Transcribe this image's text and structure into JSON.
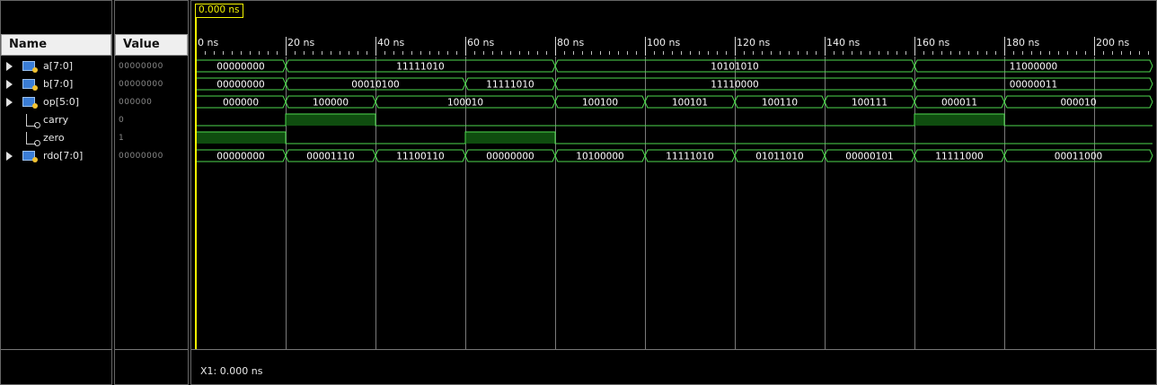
{
  "columns": {
    "name": "Name",
    "value": "Value"
  },
  "cursor": {
    "marker": "0.000 ns",
    "readout": "X1: 0.000 ns"
  },
  "timeline": {
    "unit": "ns",
    "start": 0,
    "end": 213,
    "ticks": [
      {
        "t": 0,
        "label": "0 ns"
      },
      {
        "t": 20,
        "label": "20 ns"
      },
      {
        "t": 40,
        "label": "40 ns"
      },
      {
        "t": 60,
        "label": "60 ns"
      },
      {
        "t": 80,
        "label": "80 ns"
      },
      {
        "t": 100,
        "label": "100 ns"
      },
      {
        "t": 120,
        "label": "120 ns"
      },
      {
        "t": 140,
        "label": "140 ns"
      },
      {
        "t": 160,
        "label": "160 ns"
      },
      {
        "t": 180,
        "label": "180 ns"
      },
      {
        "t": 200,
        "label": "200 ns"
      }
    ]
  },
  "signals": [
    {
      "name": "a[7:0]",
      "kind": "bus",
      "value": "00000000",
      "icon": "bus-signal-icon",
      "segments": [
        {
          "t0": 0,
          "t1": 20,
          "v": "00000000"
        },
        {
          "t0": 20,
          "t1": 80,
          "v": "11111010"
        },
        {
          "t0": 80,
          "t1": 160,
          "v": "10101010"
        },
        {
          "t0": 160,
          "t1": 213,
          "v": "11000000"
        }
      ]
    },
    {
      "name": "b[7:0]",
      "kind": "bus",
      "value": "00000000",
      "icon": "bus-signal-icon",
      "segments": [
        {
          "t0": 0,
          "t1": 20,
          "v": "00000000"
        },
        {
          "t0": 20,
          "t1": 60,
          "v": "00010100"
        },
        {
          "t0": 60,
          "t1": 80,
          "v": "11111010"
        },
        {
          "t0": 80,
          "t1": 160,
          "v": "11110000"
        },
        {
          "t0": 160,
          "t1": 213,
          "v": "00000011"
        }
      ]
    },
    {
      "name": "op[5:0]",
      "kind": "bus",
      "value": "000000",
      "icon": "bus-signal-icon",
      "segments": [
        {
          "t0": 0,
          "t1": 20,
          "v": "000000"
        },
        {
          "t0": 20,
          "t1": 40,
          "v": "100000"
        },
        {
          "t0": 40,
          "t1": 80,
          "v": "100010"
        },
        {
          "t0": 80,
          "t1": 100,
          "v": "100100"
        },
        {
          "t0": 100,
          "t1": 120,
          "v": "100101"
        },
        {
          "t0": 120,
          "t1": 140,
          "v": "100110"
        },
        {
          "t0": 140,
          "t1": 160,
          "v": "100111"
        },
        {
          "t0": 160,
          "t1": 180,
          "v": "000011"
        },
        {
          "t0": 180,
          "t1": 213,
          "v": "000010"
        }
      ]
    },
    {
      "name": "carry",
      "kind": "bit",
      "value": "0",
      "icon": "bit-signal-icon",
      "segments": [
        {
          "t0": 0,
          "t1": 20,
          "v": 0
        },
        {
          "t0": 20,
          "t1": 40,
          "v": 1
        },
        {
          "t0": 40,
          "t1": 160,
          "v": 0
        },
        {
          "t0": 160,
          "t1": 180,
          "v": 1
        },
        {
          "t0": 180,
          "t1": 213,
          "v": 0
        }
      ]
    },
    {
      "name": "zero",
      "kind": "bit",
      "value": "1",
      "icon": "bit-signal-icon",
      "segments": [
        {
          "t0": 0,
          "t1": 20,
          "v": 1
        },
        {
          "t0": 20,
          "t1": 60,
          "v": 0
        },
        {
          "t0": 60,
          "t1": 80,
          "v": 1
        },
        {
          "t0": 80,
          "t1": 213,
          "v": 0
        }
      ]
    },
    {
      "name": "rdo[7:0]",
      "kind": "bus",
      "value": "00000000",
      "icon": "bus-signal-icon",
      "segments": [
        {
          "t0": 0,
          "t1": 20,
          "v": "00000000"
        },
        {
          "t0": 20,
          "t1": 40,
          "v": "00001110"
        },
        {
          "t0": 40,
          "t1": 60,
          "v": "11100110"
        },
        {
          "t0": 60,
          "t1": 80,
          "v": "00000000"
        },
        {
          "t0": 80,
          "t1": 100,
          "v": "10100000"
        },
        {
          "t0": 100,
          "t1": 120,
          "v": "11111010"
        },
        {
          "t0": 120,
          "t1": 140,
          "v": "01011010"
        },
        {
          "t0": 140,
          "t1": 160,
          "v": "00000101"
        },
        {
          "t0": 160,
          "t1": 180,
          "v": "11111000"
        },
        {
          "t0": 180,
          "t1": 213,
          "v": "00011000"
        }
      ]
    }
  ],
  "colors": {
    "wave": "#4ed94e",
    "high_fill": "#0f4d0f",
    "cursor": "#f5f500",
    "grid": "#7a7a7a"
  }
}
